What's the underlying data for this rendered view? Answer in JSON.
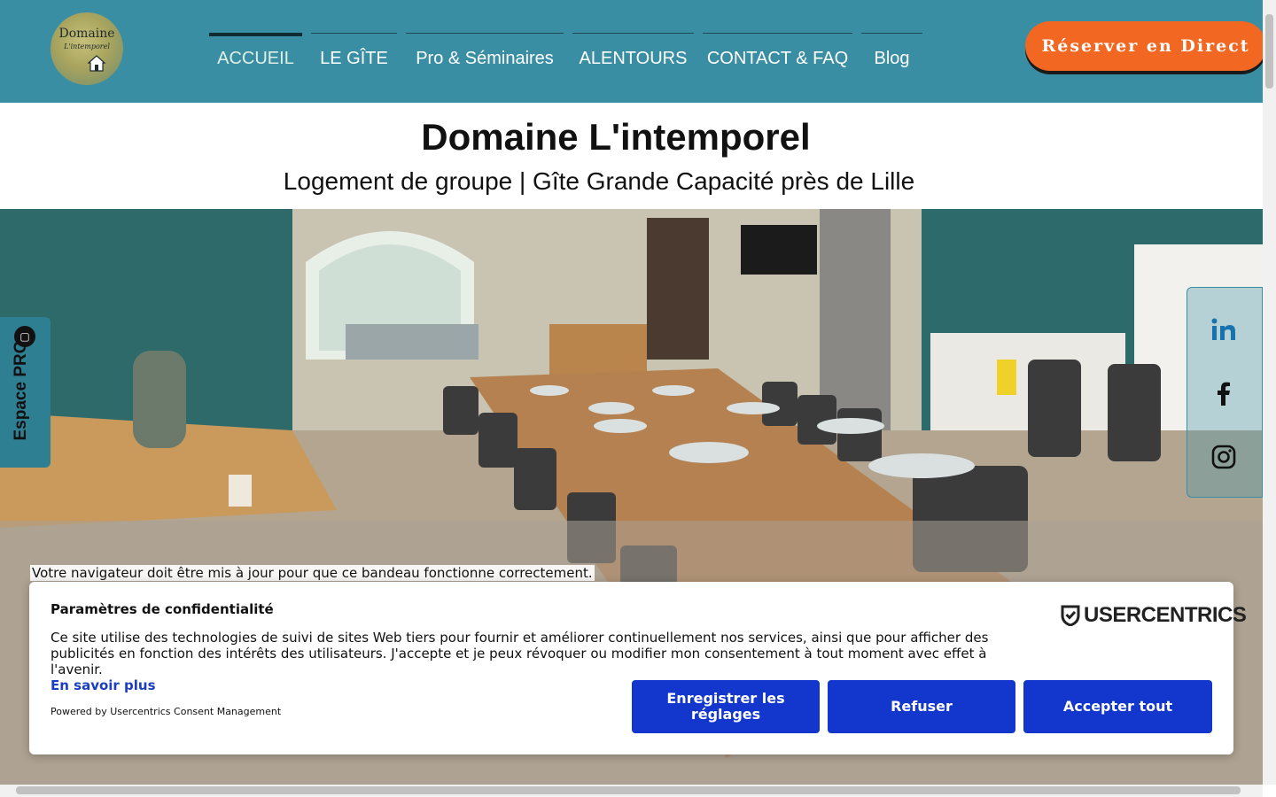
{
  "header": {
    "logo": {
      "line1": "Domaine",
      "line2": "L'intemporel"
    },
    "nav": [
      {
        "label": "ACCUEIL",
        "active": true
      },
      {
        "label": "LE GÎTE",
        "active": false
      },
      {
        "label": "Pro & Séminaires",
        "active": false
      },
      {
        "label": "ALENTOURS",
        "active": false
      },
      {
        "label": "CONTACT & FAQ",
        "active": false
      },
      {
        "label": "Blog",
        "active": false
      }
    ],
    "reserve_label": "Réserver en Direct",
    "colors": {
      "bar": "#3a8ea3",
      "reserve": "#f26722"
    }
  },
  "main": {
    "title": "Domaine L'intemporel",
    "subtitle": "Logement de groupe | Gîte Grande Capacité près de Lille"
  },
  "side": {
    "espace_pro_label": "Espace PRO",
    "social": [
      "linkedin-icon",
      "facebook-icon",
      "instagram-icon"
    ]
  },
  "consent": {
    "browser_warning": "Votre navigateur doit être mis à jour pour que ce bandeau fonctionne correctement.",
    "title": "Paramètres de confidentialité",
    "text": "Ce site utilise des technologies de suivi de sites Web tiers pour fournir et améliorer continuellement nos services, ainsi que pour afficher des publicités en fonction des intérêts des utilisateurs. J'accepte et je peux révoquer ou modifier mon consentement à tout moment avec effet à l'avenir.",
    "learn_more": "En savoir plus",
    "powered_by": "Powered by Usercentrics Consent Management",
    "brand": "USERCENTRICS",
    "buttons": {
      "save": "Enregistrer les réglages",
      "refuse": "Refuser",
      "accept": "Accepter tout"
    },
    "button_color": "#1336cc"
  }
}
